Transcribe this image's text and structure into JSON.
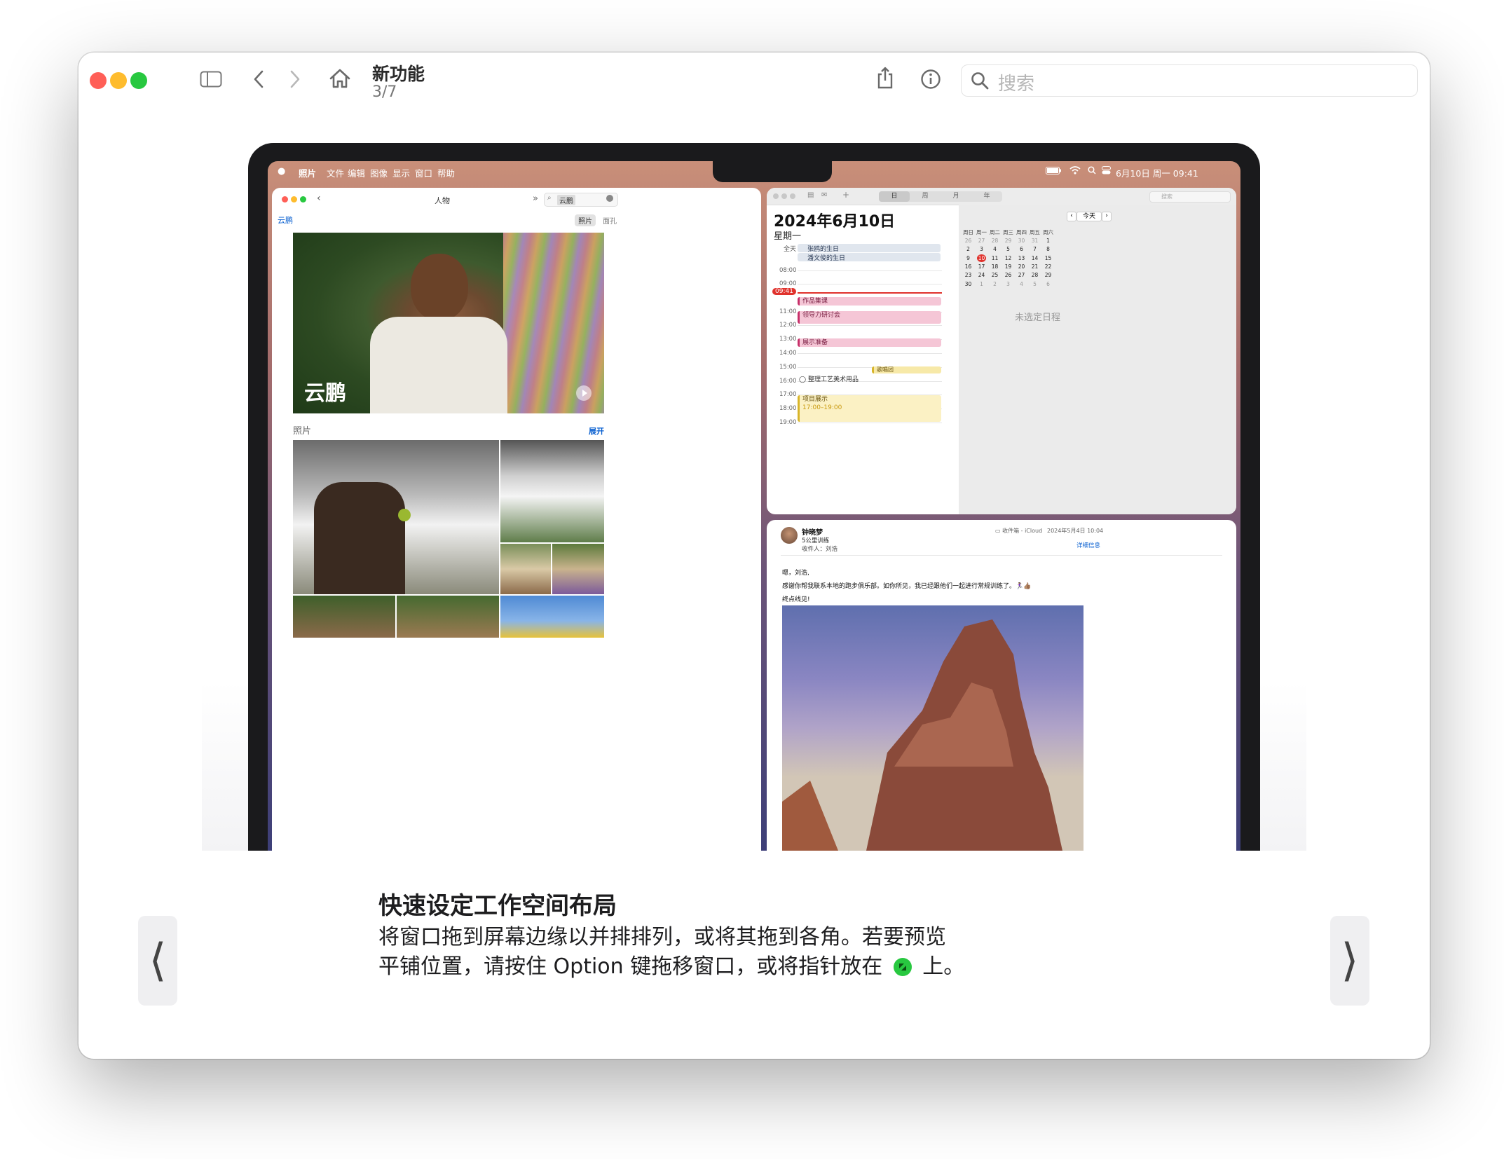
{
  "toolbar": {
    "title": "新功能",
    "page_indicator": "3/7",
    "search_placeholder": "搜索"
  },
  "menubar": {
    "items": [
      "照片",
      "文件",
      "编辑",
      "图像",
      "显示",
      "窗口",
      "帮助"
    ],
    "datetime": "6月10日 周一  09:41"
  },
  "photos": {
    "title": "人物",
    "search_value": "云鹏",
    "back_label": "云鹏",
    "seg_photos": "照片",
    "seg_faces": "面孔",
    "hero_name": "云鹏",
    "section_label": "照片",
    "expand_label": "展开"
  },
  "calendar": {
    "view_tabs": [
      "日",
      "周",
      "月",
      "年"
    ],
    "search_placeholder": "搜索",
    "date_title": "2024年6月10日",
    "weekday": "星期一",
    "all_day_label": "全天",
    "all_day_events": [
      "张鸥的生日",
      "潘文俊的生日"
    ],
    "hours": [
      "08:00",
      "09:00",
      "11:00",
      "12:00",
      "13:00",
      "14:00",
      "15:00",
      "16:00",
      "17:00",
      "18:00",
      "19:00"
    ],
    "now_label": "09:41",
    "events": {
      "e1": "作品集课",
      "e2": "领导力研讨会",
      "e3": "展示准备",
      "e4": "歌唱团",
      "e5": "整理工艺美术用品",
      "e6": "项目展示",
      "e6_time": "17:00–19:00"
    },
    "today_button": "今天",
    "mini_weekdays": [
      "周日",
      "周一",
      "周二",
      "周三",
      "周四",
      "周五",
      "周六"
    ],
    "mini_rows": [
      [
        "26",
        "27",
        "28",
        "29",
        "30",
        "31",
        "1"
      ],
      [
        "2",
        "3",
        "4",
        "5",
        "6",
        "7",
        "8"
      ],
      [
        "9",
        "10",
        "11",
        "12",
        "13",
        "14",
        "15"
      ],
      [
        "16",
        "17",
        "18",
        "19",
        "20",
        "21",
        "22"
      ],
      [
        "23",
        "24",
        "25",
        "26",
        "27",
        "28",
        "29"
      ],
      [
        "30",
        "1",
        "2",
        "3",
        "4",
        "5",
        "6"
      ]
    ],
    "no_selection": "未选定日程"
  },
  "mail": {
    "sender": "钟晓梦",
    "subject": "5公里训练",
    "to_line": "收件人：刘浩",
    "mailbox": "收件箱 - iCloud",
    "date": "2024年5月4日 10:04",
    "details": "详细信息",
    "greeting": "嗯，刘浩,",
    "body": "感谢你帮我联系本地的跑步俱乐部。如你所见，我已经跟他们一起进行常规训练了。🏃🏽‍♀️👍🏽",
    "closing": "终点线见!"
  },
  "caption": {
    "title": "快速设定工作空间布局",
    "line1": "将窗口拖到屏幕边缘以并排排列，或将其拖到各角。若要预览",
    "line2_a": "平铺位置，请按住 Option 键拖移窗口，或将指针放在",
    "line2_b": "上。"
  },
  "nav": {
    "prev": "⟨",
    "next": "⟩"
  },
  "colors": {
    "close": "#ff5f57",
    "minimize": "#febc2e",
    "zoom": "#28c840",
    "accent": "#0a60d0",
    "calendar_event": "#f5c6d6",
    "calendar_today": "#e0322c"
  }
}
